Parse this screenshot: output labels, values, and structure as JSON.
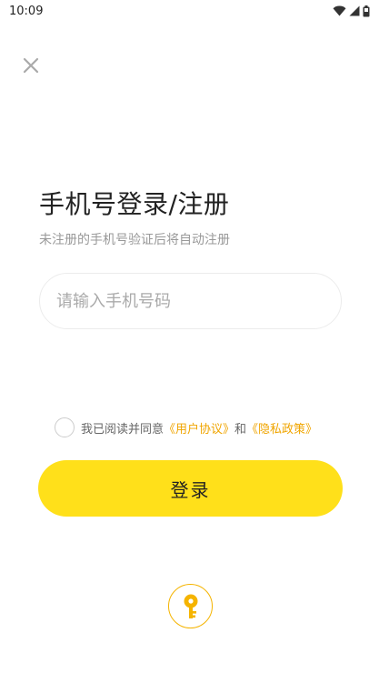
{
  "status_bar": {
    "time": "10:09",
    "icons": [
      "wifi-icon",
      "signal-icon",
      "battery-icon"
    ]
  },
  "close": {
    "icon": "close-icon"
  },
  "header": {
    "title": "手机号登录/注册",
    "subtitle": "未注册的手机号验证后将自动注册"
  },
  "phone": {
    "placeholder": "请输入手机号码",
    "value": ""
  },
  "agreement": {
    "checked": false,
    "prefix": "我已阅读并同意",
    "user_agreement": "《用户协议》",
    "and": "和",
    "privacy_policy": "《隐私政策》"
  },
  "login": {
    "label": "登录"
  },
  "key_login": {
    "icon": "key-icon"
  },
  "colors": {
    "accent": "#ffe01a",
    "link": "#f0a500",
    "key": "#f5b400"
  }
}
